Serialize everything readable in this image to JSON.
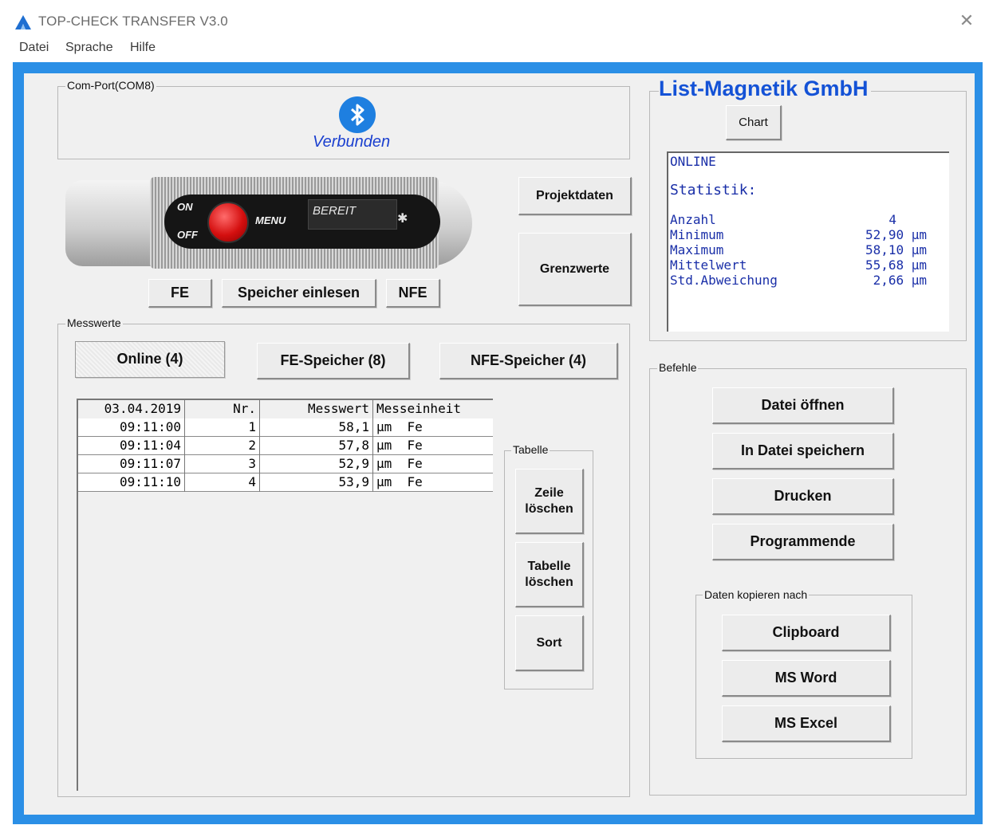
{
  "window": {
    "title": "TOP-CHECK TRANSFER V3.0",
    "close_glyph": "✕",
    "menu": [
      "Datei",
      "Sprache",
      "Hilfe"
    ]
  },
  "comport": {
    "group_label": "Com-Port(COM8)",
    "status": "Verbunden",
    "icon": "bluetooth-icon"
  },
  "device": {
    "on_label": "ON",
    "off_label": "OFF",
    "menu_label": "MENU",
    "screen_text": "BEREIT",
    "screen_icon": "bluetooth-icon"
  },
  "device_buttons": {
    "fe": "FE",
    "read_memory": "Speicher einlesen",
    "nfe": "NFE"
  },
  "side_buttons": {
    "project": "Projektdaten",
    "limits": "Grenzwerte"
  },
  "measurements": {
    "group_label": "Messwerte",
    "tabs": [
      "Online (4)",
      "FE-Speicher (8)",
      "NFE-Speicher (4)"
    ],
    "active_tab": "Online (4)",
    "header": {
      "date": "03.04.2019",
      "nr": "Nr.",
      "value": "Messwert",
      "unit": "Messeinheit"
    },
    "rows": [
      {
        "time": "09:11:00",
        "nr": "1",
        "value": "58,1",
        "unit": "µm  Fe"
      },
      {
        "time": "09:11:04",
        "nr": "2",
        "value": "57,8",
        "unit": "µm  Fe"
      },
      {
        "time": "09:11:07",
        "nr": "3",
        "value": "52,9",
        "unit": "µm  Fe"
      },
      {
        "time": "09:11:10",
        "nr": "4",
        "value": "53,9",
        "unit": "µm  Fe"
      }
    ]
  },
  "table_group": {
    "label": "Tabelle",
    "delete_row_l1": "Zeile",
    "delete_row_l2": "löschen",
    "delete_table_l1": "Tabelle",
    "delete_table_l2": "löschen",
    "sort": "Sort"
  },
  "brand": {
    "name": "List-Magnetik GmbH",
    "chart_button": "Chart"
  },
  "stats": {
    "mode": "ONLINE",
    "heading": "Statistik:",
    "rows": [
      {
        "name": "Anzahl",
        "value": "4"
      },
      {
        "name": "Minimum",
        "value": "52,90 µm"
      },
      {
        "name": "Maximum",
        "value": "58,10 µm"
      },
      {
        "name": "Mittelwert",
        "value": "55,68 µm"
      },
      {
        "name": "Std.Abweichung",
        "value": "2,66 µm"
      }
    ]
  },
  "commands": {
    "label": "Befehle",
    "open": "Datei öffnen",
    "save": "In Datei speichern",
    "print": "Drucken",
    "exit": "Programmende"
  },
  "copy": {
    "label": "Daten kopieren nach",
    "clipboard": "Clipboard",
    "word": "MS Word",
    "excel": "MS Excel"
  },
  "colors": {
    "frame_blue": "#2b8fe6",
    "status_blue": "#1a3fcf",
    "brand_blue": "#1452d6",
    "stats_text": "#1a2fa8"
  }
}
